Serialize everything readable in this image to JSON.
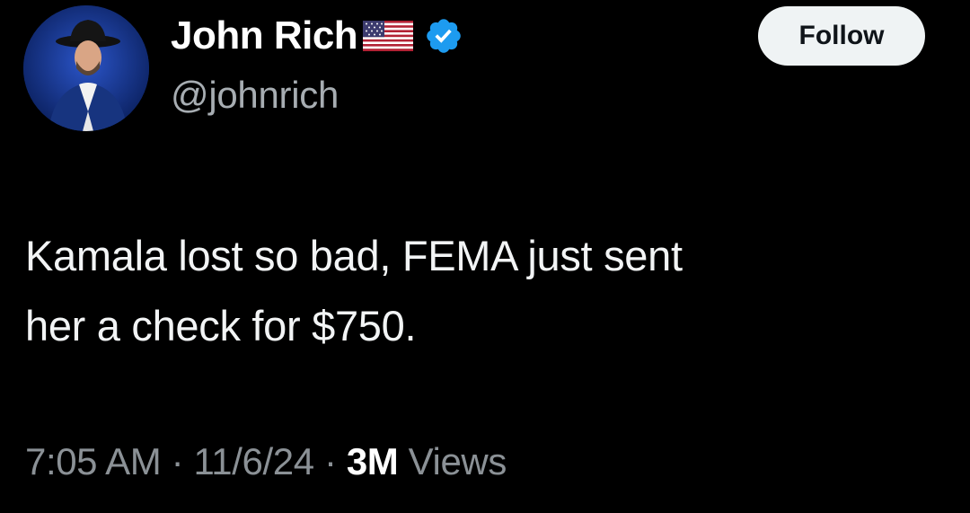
{
  "author": {
    "display_name": "John Rich",
    "flag_emoji": "🇺🇸",
    "handle": "@johnrich",
    "verified": true,
    "verified_color": "#1d9bf0"
  },
  "follow_button": {
    "label": "Follow"
  },
  "tweet": {
    "text_lines": [
      "Kamala lost so bad, FEMA just sent",
      "her a check for $750."
    ]
  },
  "meta": {
    "time": "7:05 AM",
    "separator": "·",
    "date": "11/6/24",
    "views_count": "3M",
    "views_label": "Views"
  },
  "icons": {
    "verified": "verified-badge-icon",
    "flag": "us-flag-icon"
  }
}
